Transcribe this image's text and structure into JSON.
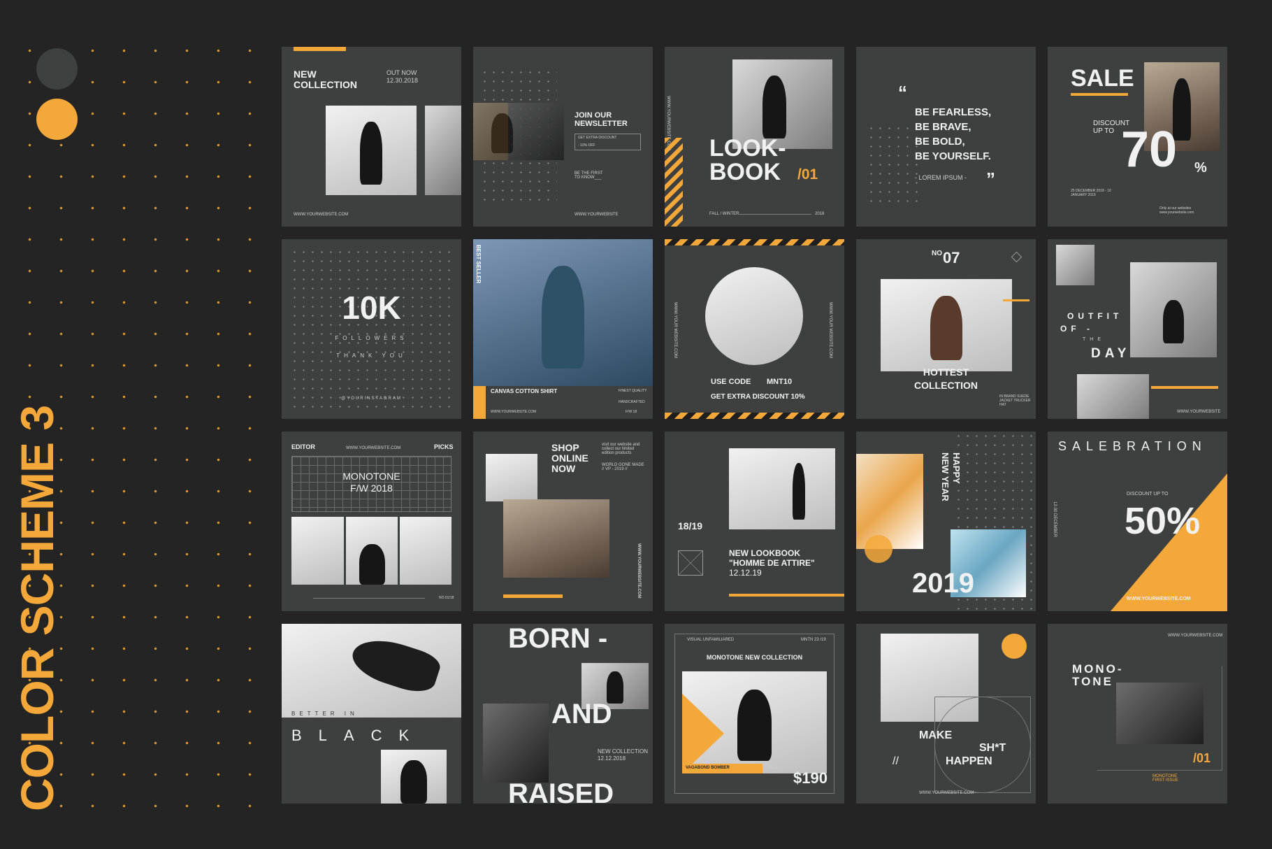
{
  "side": {
    "title": "COLOR SCHEME 3",
    "colors": {
      "gray": "#3f4040",
      "orange": "#f4a83a",
      "bg": "#242424"
    }
  },
  "tiles": {
    "t1": {
      "title": "NEW COLLECTION",
      "date_label": "OUT NOW",
      "date": "12.30.2018",
      "url": "WWW.YOURWEBSITE.COM"
    },
    "t2": {
      "title": "JOIN OUR NEWSLETTER",
      "sub": "GET EXTRA DISCOUNT",
      "off": "- 10% OFF",
      "first": "BE THE FIRST TO KNOW___",
      "url": "WWW.YOURWEBSITE"
    },
    "t3": {
      "title1": "LOOK-",
      "title2": "BOOK",
      "num": "/01",
      "url": "WWW.YOURWEBSITE.COM",
      "season": "FALL / WINTER",
      "year": "2018"
    },
    "t4": {
      "q1": "BE FEARLESS,",
      "q2": "BE BRAVE,",
      "q3": "BE BOLD,",
      "q4": "BE YOURSELF.",
      "author": "- LOREM IPSUM -",
      "open": "“",
      "close": "”"
    },
    "t5": {
      "title": "SALE",
      "disc": "DISCOUNT UP TO",
      "num": "70",
      "pct": "%",
      "dates": "25 DECEMBER 2018 - 10 JANUARY 2019",
      "note": "Only at our websites www.yourwebsite.com"
    },
    "t6": {
      "num": "10K",
      "f": "FOLLOWERS",
      "ty": "THANK YOU",
      "handle": "@YOURINSTAGRAM"
    },
    "t7": {
      "badge": "BEST SELLER",
      "title": "CANVAS COTTON SHIRT",
      "q": "FINEST QUALITY",
      "h": "HANDCRAFTED",
      "season": "F/W 18",
      "url": "WWW.YOURWEBSITE.COM"
    },
    "t8": {
      "code_label": "USE CODE",
      "code": "MNT10",
      "extra": "GET EXTRA DISCOUNT 10%",
      "url": "WWW.YOUR WEBSITE.COM"
    },
    "t9": {
      "no": "NO",
      "num": "07",
      "title1": "HOTTEST",
      "title2": "COLLECTION",
      "item": "IN BRAND SUEDE JACKET TRUCKER HAT"
    },
    "t10": {
      "w1": "OUTFIT",
      "w2": "OF -",
      "w3": "THE",
      "w4": "DAY",
      "url": "WWW.YOURWEBSITE"
    },
    "t11": {
      "editor": "EDITOR",
      "picks": "PICKS",
      "url": "WWW.YOURWEBSITE.COM",
      "title": "MONOTONE",
      "sub": "F/W 2018",
      "issue": "NO.01/18"
    },
    "t12": {
      "title1": "SHOP",
      "title2": "ONLINE",
      "title3": "NOW",
      "desc": "visit our website and collect our limited edition products",
      "world": "WORLD GONE MADE // VP - 2019 //",
      "url": "WWW.YOURWEBSITE.COM"
    },
    "t13": {
      "year": "18/19",
      "title1": "NEW LOOKBOOK",
      "title2": "\"HOMME DE ATTIRE\"",
      "date": "12.12.19"
    },
    "t14": {
      "year": "2019",
      "w1": "HAPPY",
      "w2": "NEW YEAR"
    },
    "t15": {
      "title": "SALEBRATION",
      "disc": "DISCOUNT UP TO",
      "num": "50%",
      "dates": "12-30 DECEMBER",
      "url": "WWW.YOURWEBSITE.COM"
    },
    "t16": {
      "better": "BETTER IN",
      "black": "BLACK"
    },
    "t17": {
      "w1": "BORN -",
      "w2": "AND",
      "w3": "RAISED",
      "new": "NEW COLLECTION",
      "date": "12.12.2018"
    },
    "t18": {
      "top": "VISUAL UNFAMILIARED",
      "issue": "MNTN 23 /19",
      "title": "MONOTONE NEW COLLECTION",
      "label": "VAGABOND BOMBER",
      "men": "MEN",
      "price": "$190"
    },
    "t19": {
      "w1": "MAKE",
      "w2": "SH*T",
      "w3": "HAPPEN",
      "mark": "//",
      "url": "WWW.YOURWEBSITE.COM"
    },
    "t20": {
      "url": "WWW.YOURWEBSITE.COM",
      "title1": "MONO-",
      "title2": "TONE",
      "num": "/01",
      "issue": "MONOTONE FIRST ISSUE"
    }
  }
}
